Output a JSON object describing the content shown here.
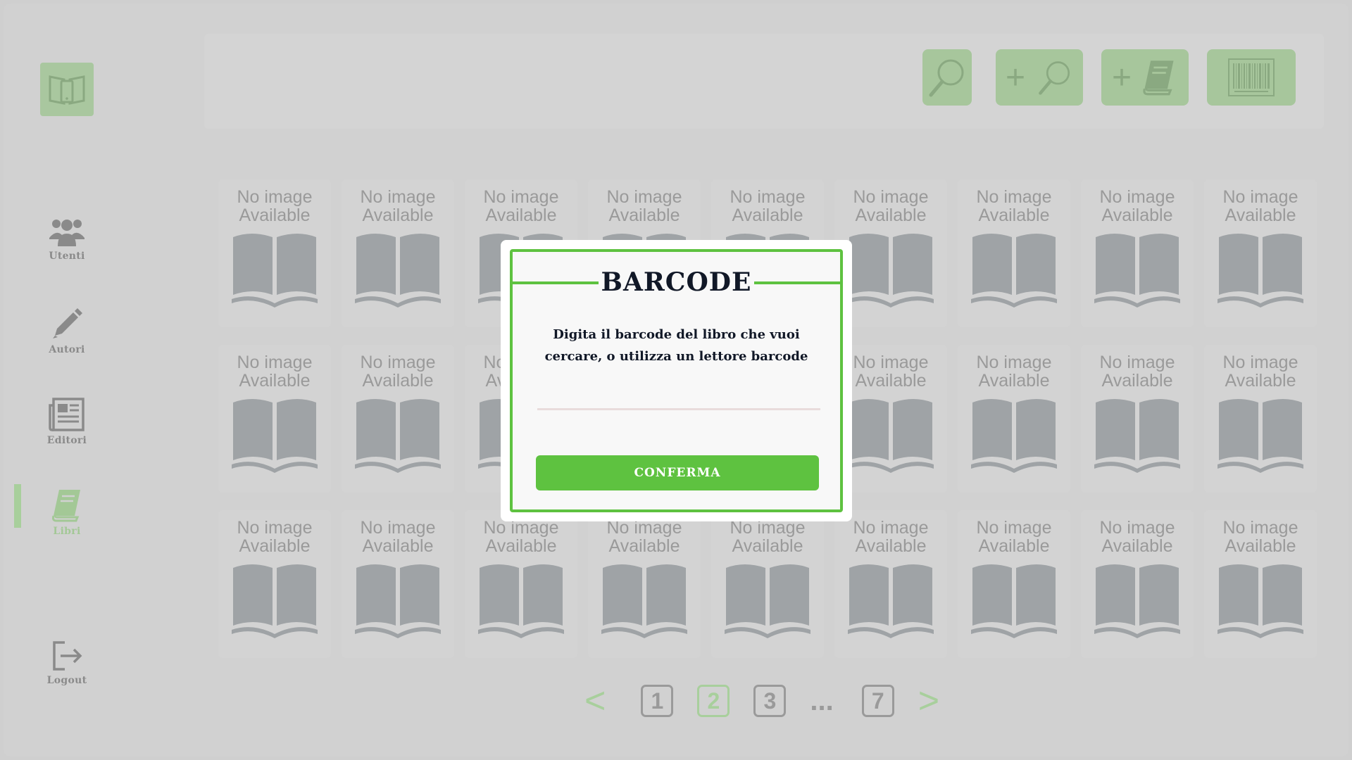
{
  "sidebar": {
    "logo_icon": "library-phone-book-icon",
    "items": [
      {
        "label": "Utenti",
        "icon": "users-icon"
      },
      {
        "label": "Autori",
        "icon": "pencil-icon"
      },
      {
        "label": "Editori",
        "icon": "newspaper-icon"
      },
      {
        "label": "Libri",
        "icon": "book-icon",
        "active": true
      }
    ],
    "logout_label": "Logout",
    "logout_icon": "logout-icon"
  },
  "toolbar": {
    "buttons": [
      {
        "icon": "search-icon"
      },
      {
        "icon": "plus-search-icon",
        "text": "+"
      },
      {
        "icon": "plus-book-icon",
        "text": "+"
      },
      {
        "icon": "barcode-icon"
      }
    ]
  },
  "books": {
    "placeholder_line1": "No image",
    "placeholder_line2": "Available",
    "rows": 3,
    "columns": 9
  },
  "pagination": {
    "prev": "<",
    "pages": [
      "1",
      "2",
      "3"
    ],
    "current": "2",
    "ellipsis": "...",
    "last": "7",
    "next": ">"
  },
  "modal": {
    "title": "BARCODE",
    "description_line1": "Digita il barcode del libro che vuoi",
    "description_line2": "cercare, o utilizza un lettore barcode",
    "input_value": "",
    "input_placeholder": "",
    "confirm_label": "CONFERMA"
  },
  "colors": {
    "accent": "#5ec240",
    "dim_accent": "#a8cf9c",
    "text_dark": "#111827"
  }
}
